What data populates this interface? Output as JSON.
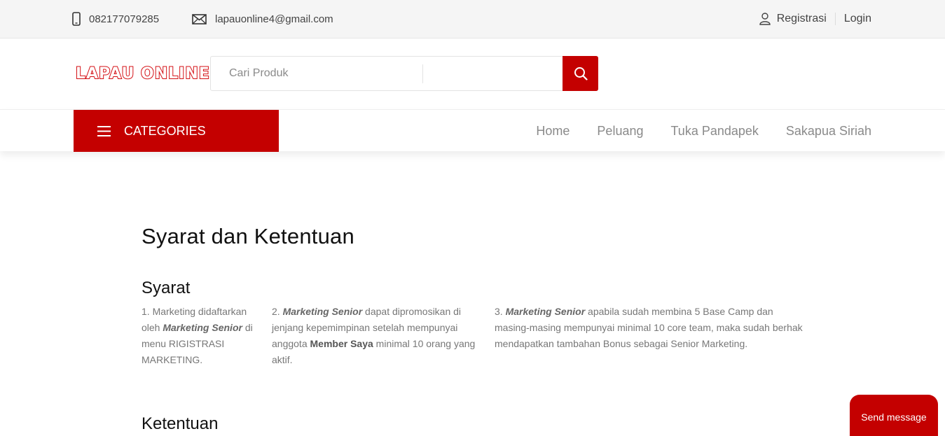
{
  "topbar": {
    "phone": "082177079285",
    "email": "lapauonline4@gmail.com",
    "register_label": "Registrasi",
    "login_label": "Login"
  },
  "header": {
    "logo_text": "LAPAU ONLINE",
    "search_placeholder": "Cari Produk",
    "icons": {
      "phone": "phone-icon",
      "email": "envelope-icon",
      "user": "user-icon",
      "search": "search-icon",
      "menu": "hamburger-icon"
    }
  },
  "nav": {
    "categories_label": "CATEGORIES",
    "items": [
      "Home",
      "Peluang",
      "Tuka Pandapek",
      "Sakapua Siriah"
    ]
  },
  "content": {
    "title": "Syarat dan Ketentuan",
    "syarat_heading": "Syarat",
    "ketentuan_heading": "Ketentuan",
    "syarat": [
      {
        "p1": "1. Marketing didaftarkan oleh ",
        "em": "Marketing Senior",
        "p2": " di menu RIGISTRASI MARKETING."
      },
      {
        "p1": "2. ",
        "em": "Marketing Senior",
        "p2": " dapat dipromosikan di jenjang kepemimpinan setelah mempunyai anggota ",
        "strong": "Member Saya",
        "p3": " minimal 10 orang yang aktif."
      },
      {
        "p1": "3. ",
        "em": "Marketing Senior",
        "p2": " apabila sudah membina 5 Base Camp dan masing-masing mempunyai minimal 10 core team, maka sudah berhak mendapatkan tambahan Bonus sebagai Senior Marketing."
      }
    ]
  },
  "chat": {
    "send_message_label": "Send message"
  },
  "colors": {
    "brand_red": "#c40000",
    "topbar_bg": "#f5f5f5",
    "text_muted": "#777777"
  }
}
